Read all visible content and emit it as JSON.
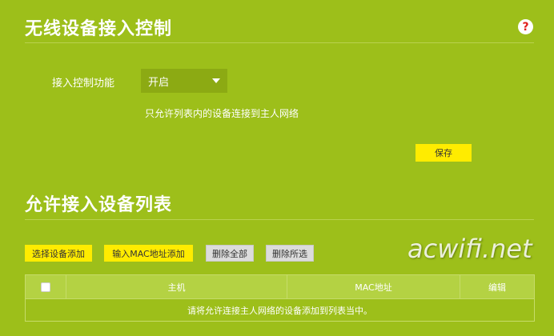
{
  "access_control": {
    "title": "无线设备接入控制",
    "help_symbol": "?",
    "label": "接入控制功能",
    "select_value": "开启",
    "hint": "只允许列表内的设备连接到主人网络",
    "save_label": "保存"
  },
  "allowed_list": {
    "title": "允许接入设备列表",
    "buttons": {
      "select_device_add": "选择设备添加",
      "input_mac_add": "输入MAC地址添加",
      "delete_all": "删除全部",
      "delete_selected": "删除所选"
    },
    "columns": {
      "host": "主机",
      "mac": "MAC地址",
      "edit": "编辑"
    },
    "empty_message": "请将允许连接主人网络的设备添加到列表当中。"
  },
  "watermark": "acwifi.net",
  "colors": {
    "background": "#9dbf1a",
    "primary_button": "#ffec00",
    "secondary_button": "#dcdcdc",
    "help_icon_mark": "#e0201c"
  }
}
